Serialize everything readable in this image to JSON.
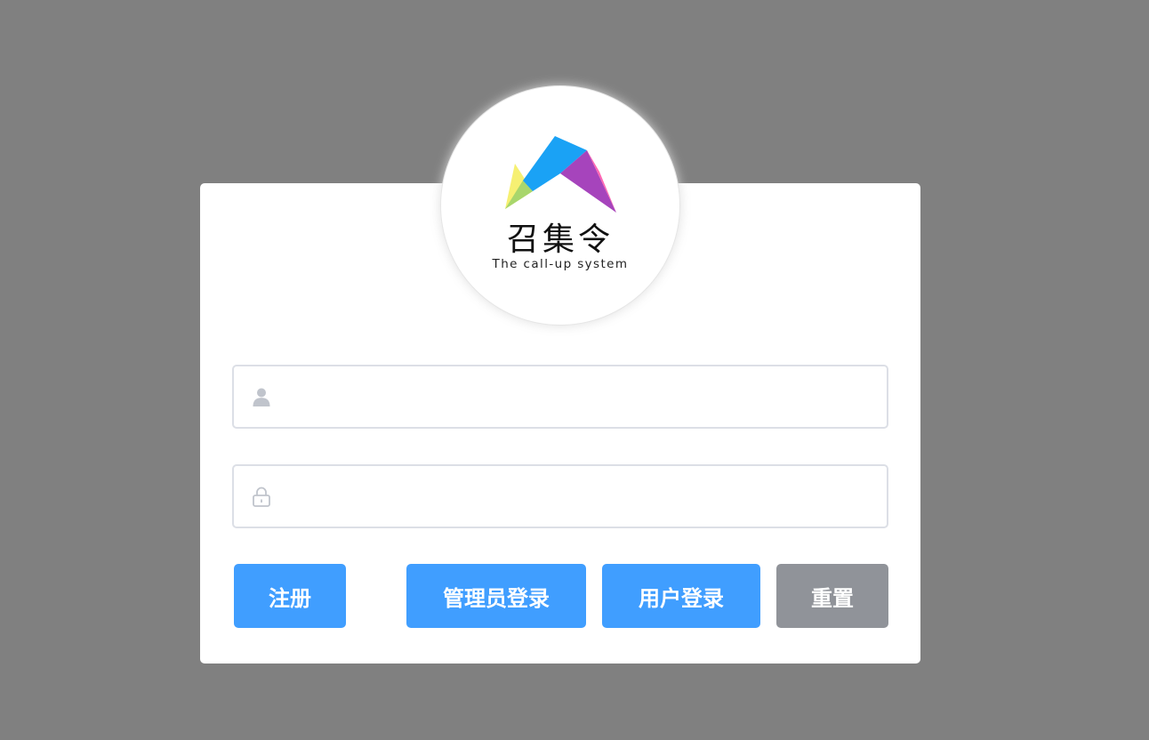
{
  "logo": {
    "title_cn": "召集令",
    "subtitle_en": "The call-up system"
  },
  "form": {
    "username": {
      "placeholder": "",
      "value": "",
      "icon": "user-icon"
    },
    "password": {
      "placeholder": "",
      "value": "",
      "icon": "lock-icon"
    }
  },
  "buttons": {
    "register": "注册",
    "admin_login": "管理员登录",
    "user_login": "用户登录",
    "reset": "重置"
  },
  "colors": {
    "background": "#808080",
    "primary": "#409eff",
    "info": "#909399",
    "input_border": "#dcdfe6",
    "icon": "#c0c4cc"
  }
}
